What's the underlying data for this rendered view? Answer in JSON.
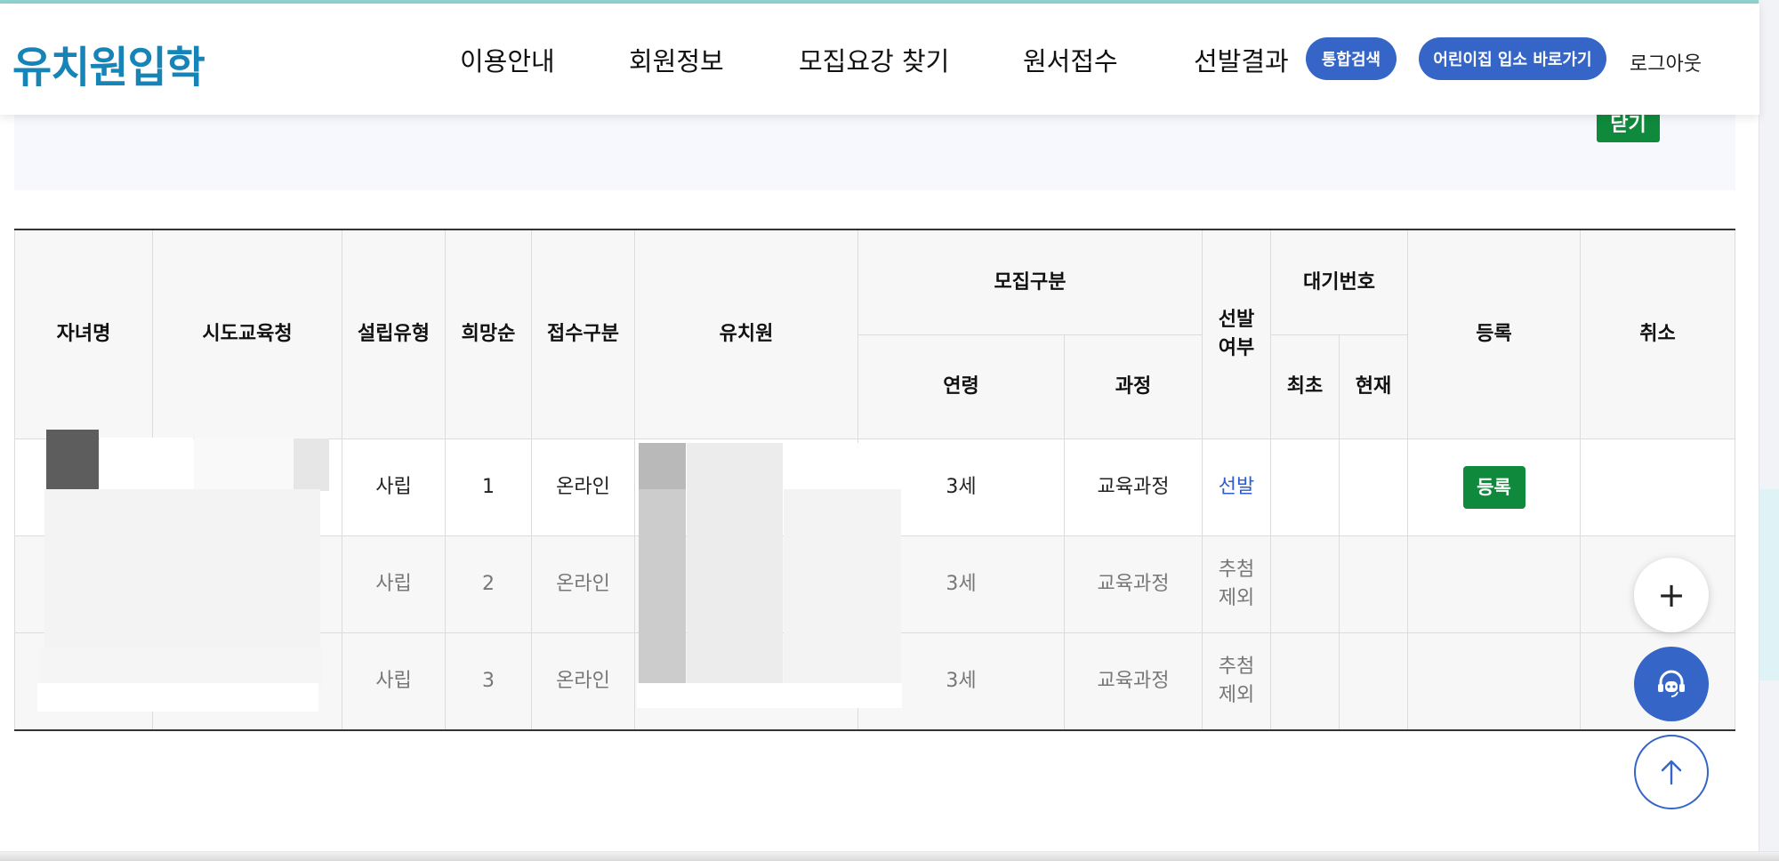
{
  "header": {
    "logo": "유치원입학",
    "nav": [
      "이용안내",
      "회원정보",
      "모집요강 찾기",
      "원서접수",
      "선발결과"
    ],
    "search_button": "통합검색",
    "daycare_button": "어린이집 입소 바로가기",
    "logout": "로그아웃"
  },
  "panel": {
    "close_button": "닫기"
  },
  "table": {
    "headers": {
      "child_name": "자녀명",
      "edu_office": "시도교육청",
      "establishment": "설립유형",
      "preference": "희망순",
      "application_type": "접수구분",
      "kindergarten": "유치원",
      "recruit_group": "모집구분",
      "age": "연령",
      "course": "과정",
      "selection_line1": "선발",
      "selection_line2": "여부",
      "waiting_no": "대기번호",
      "waiting_first": "최초",
      "waiting_current": "현재",
      "register": "등록",
      "cancel": "취소"
    },
    "rows": [
      {
        "establishment": "사립",
        "preference": "1",
        "application_type": "온라인",
        "age": "3세",
        "course": "교육과정",
        "selection": "선발",
        "register_button": "등록"
      },
      {
        "establishment": "사립",
        "preference": "2",
        "application_type": "온라인",
        "age": "3세",
        "course": "교육과정",
        "selection_line1": "추첨",
        "selection_line2": "제외"
      },
      {
        "establishment": "사립",
        "preference": "3",
        "application_type": "온라인",
        "age": "3세",
        "course": "교육과정",
        "selection_line1": "추첨",
        "selection_line2": "제외"
      }
    ]
  },
  "icons": {
    "plus": "plus-icon",
    "chat": "headset-chatbot-icon",
    "top": "arrow-up-icon"
  },
  "colors": {
    "brand": "#1684b6",
    "primary_button": "#3565c7",
    "register_green": "#0f8a3c",
    "selection_link": "#2d5bd1"
  }
}
